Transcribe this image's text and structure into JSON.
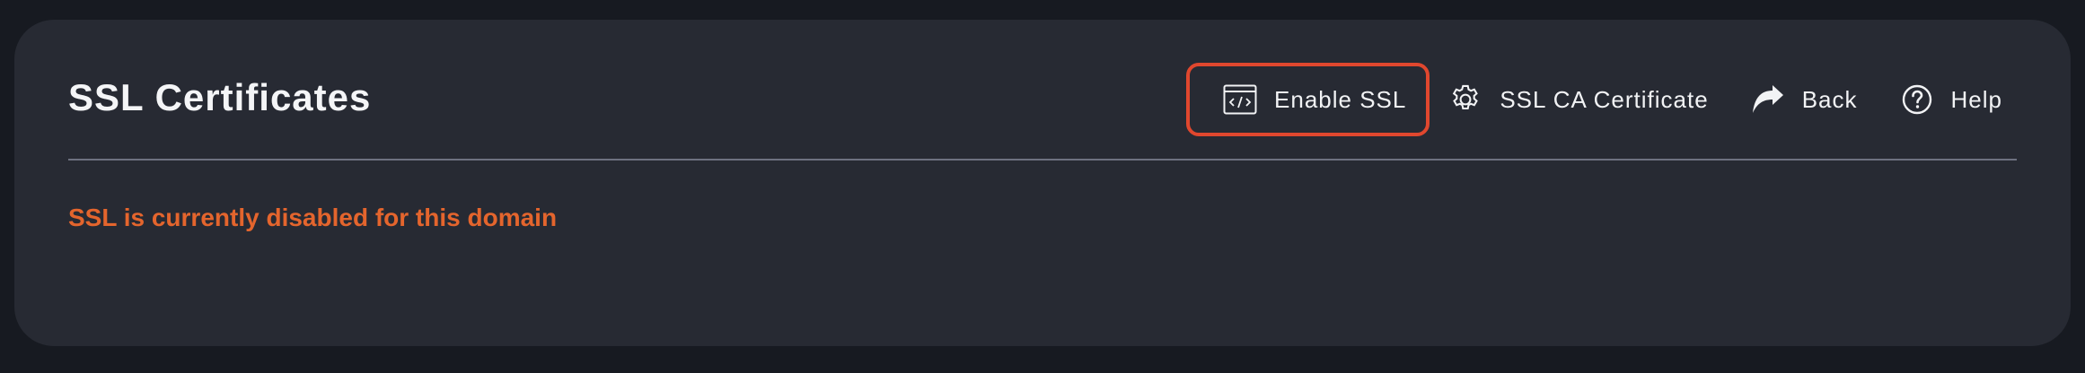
{
  "page": {
    "title": "SSL Certificates",
    "status_message": "SSL is currently disabled for this domain"
  },
  "actions": {
    "enable_ssl": {
      "label": "Enable SSL",
      "icon": "code-window-icon"
    },
    "ssl_ca_certificate": {
      "label": "SSL CA Certificate",
      "icon": "gear-icon"
    },
    "back": {
      "label": "Back",
      "icon": "share-arrow-icon"
    },
    "help": {
      "label": "Help",
      "icon": "question-circle-icon"
    }
  },
  "colors": {
    "background": "#171a21",
    "panel": "#272a33",
    "text": "#f4f5f7",
    "status": "#e4652d",
    "highlight": "#e0472e",
    "divider": "#6d7180"
  }
}
